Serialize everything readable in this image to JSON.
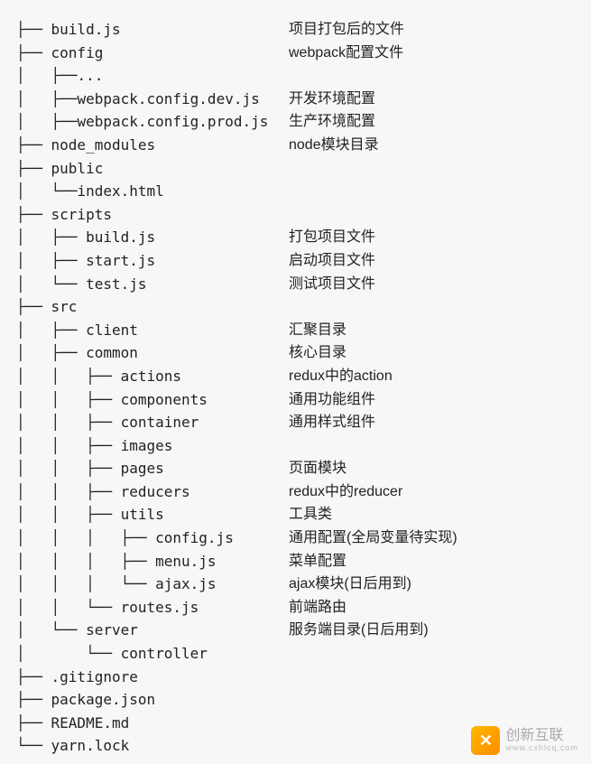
{
  "tree": [
    {
      "prefix": "├── ",
      "name": "build.js",
      "desc": "项目打包后的文件"
    },
    {
      "prefix": "├── ",
      "name": "config",
      "desc": "webpack配置文件"
    },
    {
      "prefix": "│   ├──",
      "name": "...",
      "desc": ""
    },
    {
      "prefix": "│   ├──",
      "name": "webpack.config.dev.js",
      "desc": "开发环境配置"
    },
    {
      "prefix": "│   ├──",
      "name": "webpack.config.prod.js",
      "desc": "生产环境配置"
    },
    {
      "prefix": "├── ",
      "name": "node_modules",
      "desc": "node模块目录"
    },
    {
      "prefix": "├── ",
      "name": "public",
      "desc": ""
    },
    {
      "prefix": "│   └──",
      "name": "index.html",
      "desc": ""
    },
    {
      "prefix": "├── ",
      "name": "scripts",
      "desc": ""
    },
    {
      "prefix": "│   ├── ",
      "name": "build.js",
      "desc": "打包项目文件"
    },
    {
      "prefix": "│   ├── ",
      "name": "start.js",
      "desc": "启动项目文件"
    },
    {
      "prefix": "│   └── ",
      "name": "test.js",
      "desc": "测试项目文件"
    },
    {
      "prefix": "├── ",
      "name": "src",
      "desc": ""
    },
    {
      "prefix": "│   ├── ",
      "name": "client",
      "desc": "汇聚目录"
    },
    {
      "prefix": "│   ├── ",
      "name": "common",
      "desc": "核心目录"
    },
    {
      "prefix": "│   │   ├── ",
      "name": "actions",
      "desc": "redux中的action"
    },
    {
      "prefix": "│   │   ├── ",
      "name": "components",
      "desc": "通用功能组件"
    },
    {
      "prefix": "│   │   ├── ",
      "name": "container",
      "desc": "通用样式组件"
    },
    {
      "prefix": "│   │   ├── ",
      "name": "images",
      "desc": ""
    },
    {
      "prefix": "│   │   ├── ",
      "name": "pages",
      "desc": "页面模块"
    },
    {
      "prefix": "│   │   ├── ",
      "name": "reducers",
      "desc": "redux中的reducer"
    },
    {
      "prefix": "│   │   ├── ",
      "name": "utils",
      "desc": "工具类"
    },
    {
      "prefix": "│   │   │   ├── ",
      "name": "config.js",
      "desc": "通用配置(全局变量待实现)"
    },
    {
      "prefix": "│   │   │   ├── ",
      "name": "menu.js",
      "desc": "菜单配置"
    },
    {
      "prefix": "│   │   │   └── ",
      "name": "ajax.js",
      "desc": "ajax模块(日后用到)"
    },
    {
      "prefix": "│   │   └── ",
      "name": "routes.js",
      "desc": "前端路由"
    },
    {
      "prefix": "│   └── ",
      "name": "server",
      "desc": "服务端目录(日后用到)"
    },
    {
      "prefix": "│       └── ",
      "name": "controller",
      "desc": ""
    },
    {
      "prefix": "├── ",
      "name": ".gitignore",
      "desc": ""
    },
    {
      "prefix": "├── ",
      "name": "package.json",
      "desc": ""
    },
    {
      "prefix": "├── ",
      "name": "README.md",
      "desc": ""
    },
    {
      "prefix": "└── ",
      "name": "yarn.lock",
      "desc": ""
    }
  ],
  "watermark": {
    "icon_text": "✕",
    "main": "创新互联",
    "sub": "www.cxhlcq.com"
  }
}
